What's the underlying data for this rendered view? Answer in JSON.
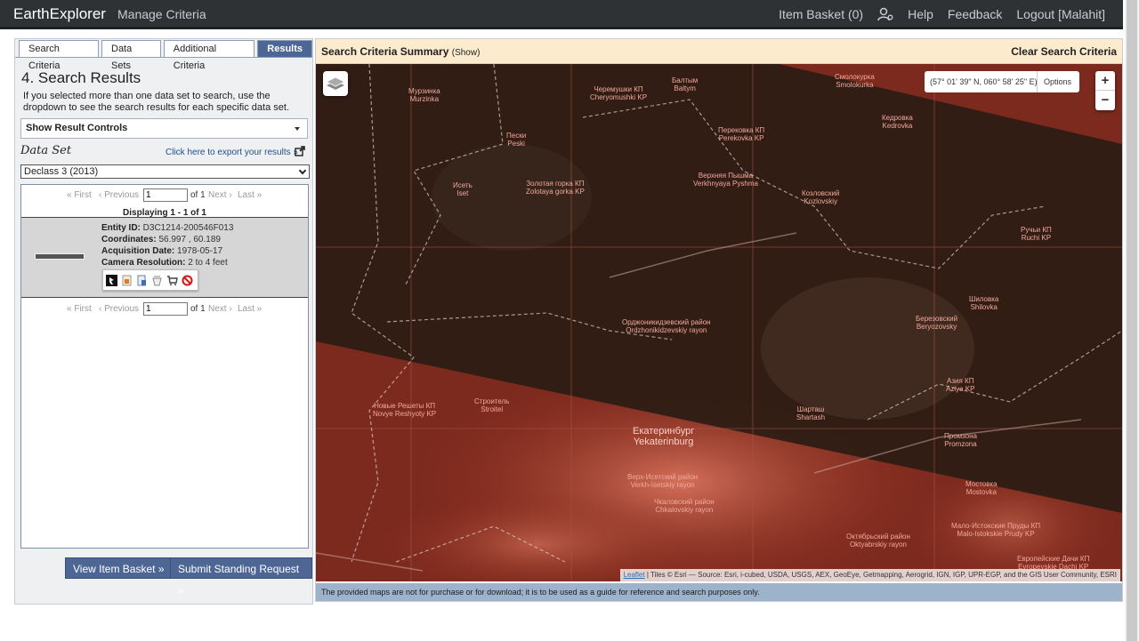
{
  "nav": {
    "brand": "EarthExplorer",
    "manage": "Manage Criteria",
    "item_basket": "Item Basket (0)",
    "help": "Help",
    "feedback": "Feedback",
    "logout": "Logout [Malahit]",
    "user_icon": "user-settings-icon"
  },
  "tabs": [
    "Search Criteria",
    "Data Sets",
    "Additional Criteria",
    "Results"
  ],
  "left": {
    "heading": "4. Search Results",
    "description": "If you selected more than one data set to search, use the dropdown to see the search results for each specific data set.",
    "show_controls": "Show Result Controls",
    "dataset_label": "Data Set",
    "export_link": "Click here to export your results »",
    "dataset_selected": "Declass 3 (2013)",
    "pager": {
      "first": "« First",
      "previous": "‹ Previous",
      "page": "1",
      "of": "of 1",
      "next": "Next ›",
      "last": "Last »"
    },
    "displaying": "Displaying 1 - 1 of 1",
    "result": {
      "entity_label": "Entity ID:",
      "entity_id": "D3C1214-200546F013",
      "coords_label": "Coordinates:",
      "coords": "56.997 , 60.189",
      "acq_label": "Acquisition Date:",
      "acq_date": "1978-05-17",
      "cam_label": "Camera Resolution:",
      "cam_res": "2 to 4 feet"
    },
    "view_basket": "View Item Basket »",
    "submit_request": "Submit Standing Request »"
  },
  "summary": {
    "title": "Search Criteria Summary",
    "show": "(Show)",
    "clear": "Clear Search Criteria"
  },
  "map": {
    "coordinates": "(57° 01' 39\" N, 060° 58' 25\" E)",
    "options": "Options",
    "zoom_in": "+",
    "zoom_out": "−",
    "attribution_link": "Leaflet",
    "attribution_rest": " | Tiles © Esri — Source: Esri, i-cubed, USDA, USGS, AEX, GeoEye, Getmapping, Aerogrid, IGN, IGP, UPR-EGP, and the GIS User Community, ESRI",
    "notice": "The provided maps are not for purchase or for download; it is to be used as a guide for reference and search purposes only.",
    "labels": {
      "city_ru": "Екатеринбург",
      "city_en": "Yekaterinburg",
      "l1": "Смолокурка",
      "l2": "Smolokurka",
      "l3": "Черемушки КП",
      "l4": "Cheryomushki KP",
      "l5": "Балтым",
      "l6": "Baltym",
      "l7": "Мурзинка",
      "l8": "Murzinka",
      "l9": "Кедровка",
      "l10": "Kedrovka",
      "l11": "Пески",
      "l12": "Peski",
      "l13": "Перековка КП",
      "l14": "Perekovka KP",
      "l15": "Золотая горка КП",
      "l16": "Zolotaya gorka KP",
      "l17": "Исеть",
      "l18": "Iset",
      "l19": "Верхняя Пышма",
      "l20": "Verkhnyaya Pyshma",
      "l21": "Козловский",
      "l22": "Kozlovskiy",
      "l23": "Ручьи КП",
      "l24": "Ruchi KP",
      "l25": "Орджоникидзевский район",
      "l26": "Ordzhonikidzevskiy rayon",
      "l27": "Шиловка",
      "l28": "Shilovka",
      "l29": "Березовский",
      "l30": "Beryozovsky",
      "l31": "Азия КП",
      "l32": "Aziya KP",
      "l33": "Новые Решеты КП",
      "l34": "Novye Reshyoty KP",
      "l35": "Строитель",
      "l36": "Stroitel",
      "l37": "Шарташ",
      "l38": "Shartash",
      "l39": "Промзона",
      "l40": "Promzona",
      "l41": "Верх-Исетский район",
      "l42": "Verkh-Isetskiy rayon",
      "l43": "Чкаловский район",
      "l44": "Chkalovskiy rayon",
      "l45": "Мостовка",
      "l46": "Mostovka",
      "l47": "Мало-Истокские Пруды КП",
      "l48": "Malo-Istokskie Prudy KP",
      "l49": "Октябрьский район",
      "l50": "Oktyabrskiy rayon",
      "l51": "Европейские Дачи КП",
      "l52": "Evropeyskie Dachi KP"
    }
  },
  "colors": {
    "nav_bg": "#2f3235",
    "tab_active": "#4d6695",
    "summary_bg": "#fcebcc",
    "notice_bg": "#9db2cb",
    "footprint_fill": "#8b1a10",
    "footprint_band": "#2b1a12"
  }
}
